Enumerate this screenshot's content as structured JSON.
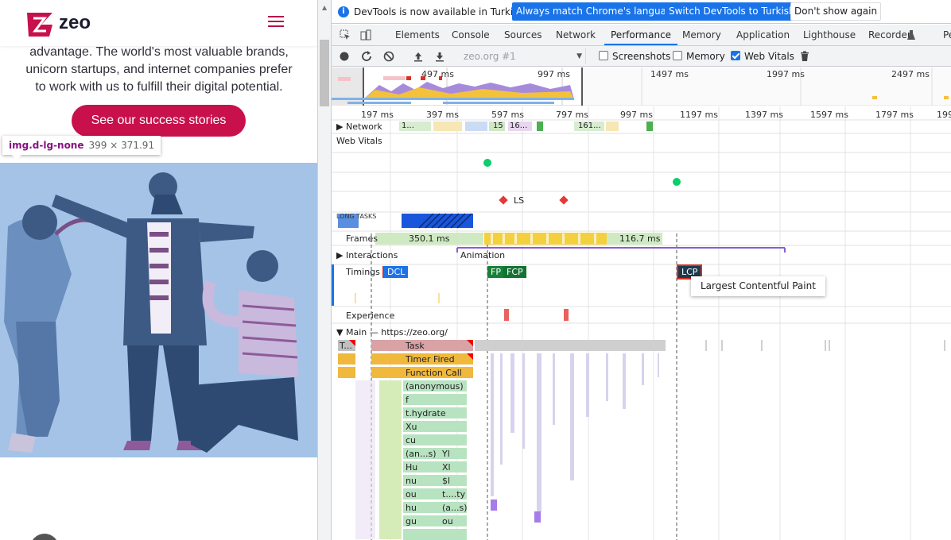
{
  "page": {
    "logo_text": "zeo",
    "hero_text": "advantage. The world's most valuable brands, unicorn startups, and internet companies prefer to work with us to fulfill their digital potential.",
    "cta_label": "See our success stories",
    "inspect_tag": "img.d-lg-none",
    "inspect_dims": "399 × 371.91",
    "colors": {
      "brand": "#c8104c",
      "illustration_bg": "#a4c3e7"
    }
  },
  "infobar": {
    "message": "DevTools is now available in Turkish!",
    "btn_match": "Always match Chrome's language",
    "btn_switch": "Switch DevTools to Turkish",
    "btn_dismiss": "Don't show again"
  },
  "tabs": [
    {
      "label": "Elements"
    },
    {
      "label": "Console"
    },
    {
      "label": "Sources"
    },
    {
      "label": "Network"
    },
    {
      "label": "Performance"
    },
    {
      "label": "Memory"
    },
    {
      "label": "Application"
    },
    {
      "label": "Lighthouse"
    },
    {
      "label": "Recorder"
    },
    {
      "label": "Pe"
    }
  ],
  "active_tab": "Performance",
  "toolbar": {
    "profile": "zeo.org #1",
    "screenshots": {
      "label": "Screenshots",
      "checked": false
    },
    "memory": {
      "label": "Memory",
      "checked": false
    },
    "web_vitals": {
      "label": "Web Vitals",
      "checked": true
    }
  },
  "overview_ticks": [
    "497 ms",
    "997 ms",
    "1497 ms",
    "1997 ms",
    "2497 ms"
  ],
  "ruler_ticks": [
    "197 ms",
    "397 ms",
    "597 ms",
    "797 ms",
    "997 ms",
    "1197 ms",
    "1397 ms",
    "1597 ms",
    "1797 ms",
    "199"
  ],
  "tracks": {
    "network": "Network",
    "network_items": [
      "1...",
      "15",
      "16...",
      "161..."
    ],
    "web_vitals": "Web Vitals",
    "ls_label": "LS",
    "long_tasks": "LONG TASKS",
    "frames": "Frames",
    "frame_values": [
      "350.1 ms",
      "116.7 ms"
    ],
    "interactions": "Interactions",
    "animation": "Animation",
    "timings": "Timings",
    "timing_badges": [
      "DCL",
      "FP",
      "FCP",
      "LCP"
    ],
    "lcp_tooltip": "Largest Contentful Paint",
    "experience": "Experience",
    "main": "Main — https://zeo.org/"
  },
  "flame": {
    "col1": [
      "Task",
      "Timer Fired",
      "Function Call",
      "(anonymous)",
      "f",
      "t.hydrate",
      "Xu",
      "cu",
      "(an...s)",
      "Hu",
      "nu",
      "ou",
      "hu",
      "gu"
    ],
    "col2": [
      "",
      "",
      "",
      "",
      "",
      "",
      "",
      "",
      "Yl",
      "Xl",
      "$l",
      "t....ty",
      "(a...s)",
      "ou"
    ],
    "task_short": "T..."
  }
}
